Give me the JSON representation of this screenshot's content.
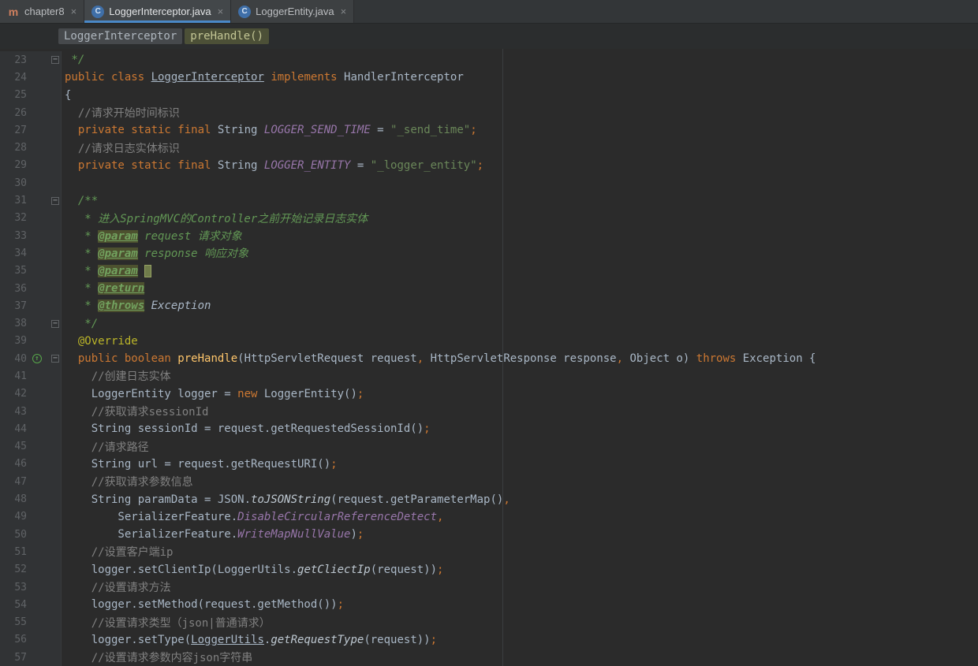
{
  "icons": {
    "maven_tab": "m",
    "class_tab": "C",
    "close": "×",
    "fold": "−",
    "override_arrow": "↑"
  },
  "colors": {
    "editor_bg": "#2b2b2b",
    "gutter_bg": "#313335",
    "tab_underline_accent": "#4a88c7",
    "keyword": "#cc7832",
    "string": "#6a8759",
    "comment": "#808080",
    "javadoc": "#629755",
    "constant": "#9876aa",
    "annotation": "#bbb529",
    "method_decl": "#ffc66b",
    "plain_text": "#a9b7c6",
    "line_number": "#606366",
    "override_icon": "#57a64a"
  },
  "tabs": [
    {
      "label": "chapter8",
      "icon": "maven",
      "selected": false
    },
    {
      "label": "LoggerInterceptor.java",
      "icon": "class",
      "selected": true
    },
    {
      "label": "LoggerEntity.java",
      "icon": "class",
      "selected": false
    }
  ],
  "breadcrumbs": [
    {
      "label": "LoggerInterceptor",
      "kind": "class"
    },
    {
      "label": "preHandle()",
      "kind": "method"
    }
  ],
  "editor": {
    "first_line": 23,
    "last_line": 57,
    "lines": [
      {
        "n": 23,
        "fold": true,
        "tokens": [
          [
            " */",
            "doc"
          ]
        ]
      },
      {
        "n": 24,
        "tokens": [
          [
            "public class ",
            "kw"
          ],
          [
            "LoggerInterceptor",
            "clsu"
          ],
          [
            " ",
            "pl"
          ],
          [
            "implements",
            "kw"
          ],
          [
            " HandlerInterceptor",
            "pl"
          ]
        ]
      },
      {
        "n": 25,
        "tokens": [
          [
            "{",
            "pl"
          ]
        ]
      },
      {
        "n": 26,
        "tokens": [
          [
            "  ",
            "pl"
          ],
          [
            "//请求开始时间标识",
            "cmt"
          ]
        ]
      },
      {
        "n": 27,
        "tokens": [
          [
            "  ",
            "pl"
          ],
          [
            "private static final ",
            "kw"
          ],
          [
            "String ",
            "pl"
          ],
          [
            "LOGGER_SEND_TIME",
            "field"
          ],
          [
            " = ",
            "pl"
          ],
          [
            "\"_send_time\"",
            "str"
          ],
          [
            ";",
            "kw"
          ]
        ]
      },
      {
        "n": 28,
        "tokens": [
          [
            "  ",
            "pl"
          ],
          [
            "//请求日志实体标识",
            "cmt"
          ]
        ]
      },
      {
        "n": 29,
        "tokens": [
          [
            "  ",
            "pl"
          ],
          [
            "private static final ",
            "kw"
          ],
          [
            "String ",
            "pl"
          ],
          [
            "LOGGER_ENTITY",
            "field"
          ],
          [
            " = ",
            "pl"
          ],
          [
            "\"_logger_entity\"",
            "str"
          ],
          [
            ";",
            "kw"
          ]
        ]
      },
      {
        "n": 30,
        "tokens": []
      },
      {
        "n": 31,
        "fold": true,
        "tokens": [
          [
            "  /**",
            "doc"
          ]
        ]
      },
      {
        "n": 32,
        "tokens": [
          [
            "   * 进入SpringMVC的Controller之前开始记录日志实体",
            "doc"
          ]
        ]
      },
      {
        "n": 33,
        "tokens": [
          [
            "   * ",
            "doc"
          ],
          [
            "@param",
            "doctag"
          ],
          [
            " request 请求对象",
            "doc"
          ]
        ]
      },
      {
        "n": 34,
        "tokens": [
          [
            "   * ",
            "doc"
          ],
          [
            "@param",
            "doctag"
          ],
          [
            " response 响应对象",
            "doc"
          ]
        ]
      },
      {
        "n": 35,
        "tokens": [
          [
            "   * ",
            "doc"
          ],
          [
            "@param",
            "doctag"
          ],
          [
            " ",
            "doc"
          ],
          [
            "",
            "box"
          ]
        ]
      },
      {
        "n": 36,
        "tokens": [
          [
            "   * ",
            "doc"
          ],
          [
            "@return",
            "doctag"
          ]
        ]
      },
      {
        "n": 37,
        "tokens": [
          [
            "   * ",
            "doc"
          ],
          [
            "@throws",
            "doctag"
          ],
          [
            " Exception",
            "docref"
          ]
        ]
      },
      {
        "n": 38,
        "fold": true,
        "tokens": [
          [
            "   */",
            "doc"
          ]
        ]
      },
      {
        "n": 39,
        "tokens": [
          [
            "  ",
            "pl"
          ],
          [
            "@Override",
            "ann"
          ]
        ]
      },
      {
        "n": 40,
        "fold": true,
        "override": true,
        "tokens": [
          [
            "  ",
            "pl"
          ],
          [
            "public boolean ",
            "kw"
          ],
          [
            "preHandle",
            "meth"
          ],
          [
            "(HttpServletRequest request",
            "pl"
          ],
          [
            ",",
            "kw"
          ],
          [
            " HttpServletResponse response",
            "pl"
          ],
          [
            ",",
            "kw"
          ],
          [
            " Object o) ",
            "pl"
          ],
          [
            "throws",
            "kw"
          ],
          [
            " Exception {",
            "pl"
          ]
        ]
      },
      {
        "n": 41,
        "tokens": [
          [
            "    ",
            "pl"
          ],
          [
            "//创建日志实体",
            "cmt"
          ]
        ]
      },
      {
        "n": 42,
        "tokens": [
          [
            "    LoggerEntity logger = ",
            "pl"
          ],
          [
            "new",
            "kw"
          ],
          [
            " LoggerEntity()",
            "pl"
          ],
          [
            ";",
            "kw"
          ]
        ]
      },
      {
        "n": 43,
        "tokens": [
          [
            "    ",
            "pl"
          ],
          [
            "//获取请求sessionId",
            "cmt"
          ]
        ]
      },
      {
        "n": 44,
        "tokens": [
          [
            "    String sessionId = request.getRequestedSessionId()",
            "pl"
          ],
          [
            ";",
            "kw"
          ]
        ]
      },
      {
        "n": 45,
        "tokens": [
          [
            "    ",
            "pl"
          ],
          [
            "//请求路径",
            "cmt"
          ]
        ]
      },
      {
        "n": 46,
        "tokens": [
          [
            "    String url = request.getRequestURI()",
            "pl"
          ],
          [
            ";",
            "kw"
          ]
        ]
      },
      {
        "n": 47,
        "tokens": [
          [
            "    ",
            "pl"
          ],
          [
            "//获取请求参数信息",
            "cmt"
          ]
        ]
      },
      {
        "n": 48,
        "tokens": [
          [
            "    String paramData = JSON.",
            "pl"
          ],
          [
            "toJSONString",
            "smeth"
          ],
          [
            "(request.getParameterMap()",
            "pl"
          ],
          [
            ",",
            "kw"
          ]
        ]
      },
      {
        "n": 49,
        "tokens": [
          [
            "        SerializerFeature.",
            "pl"
          ],
          [
            "DisableCircularReferenceDetect",
            "field"
          ],
          [
            ",",
            "kw"
          ]
        ]
      },
      {
        "n": 50,
        "tokens": [
          [
            "        SerializerFeature.",
            "pl"
          ],
          [
            "WriteMapNullValue",
            "field"
          ],
          [
            ")",
            "pl"
          ],
          [
            ";",
            "kw"
          ]
        ]
      },
      {
        "n": 51,
        "tokens": [
          [
            "    ",
            "pl"
          ],
          [
            "//设置客户端ip",
            "cmt"
          ]
        ]
      },
      {
        "n": 52,
        "tokens": [
          [
            "    logger.setClientIp(LoggerUtils.",
            "pl"
          ],
          [
            "getCliectIp",
            "smeth"
          ],
          [
            "(request))",
            "pl"
          ],
          [
            ";",
            "kw"
          ]
        ]
      },
      {
        "n": 53,
        "tokens": [
          [
            "    ",
            "pl"
          ],
          [
            "//设置请求方法",
            "cmt"
          ]
        ]
      },
      {
        "n": 54,
        "tokens": [
          [
            "    logger.setMethod(request.getMethod())",
            "pl"
          ],
          [
            ";",
            "kw"
          ]
        ]
      },
      {
        "n": 55,
        "tokens": [
          [
            "    ",
            "pl"
          ],
          [
            "//设置请求类型（json|普通请求）",
            "cmt"
          ]
        ]
      },
      {
        "n": 56,
        "tokens": [
          [
            "    logger.setType(",
            "pl"
          ],
          [
            "LoggerUtils",
            "clsu"
          ],
          [
            ".",
            "pl"
          ],
          [
            "getRequestType",
            "smeth"
          ],
          [
            "(request))",
            "pl"
          ],
          [
            ";",
            "kw"
          ]
        ]
      },
      {
        "n": 57,
        "tokens": [
          [
            "    ",
            "pl"
          ],
          [
            "//设置请求参数内容json字符串",
            "cmt"
          ]
        ]
      }
    ]
  }
}
